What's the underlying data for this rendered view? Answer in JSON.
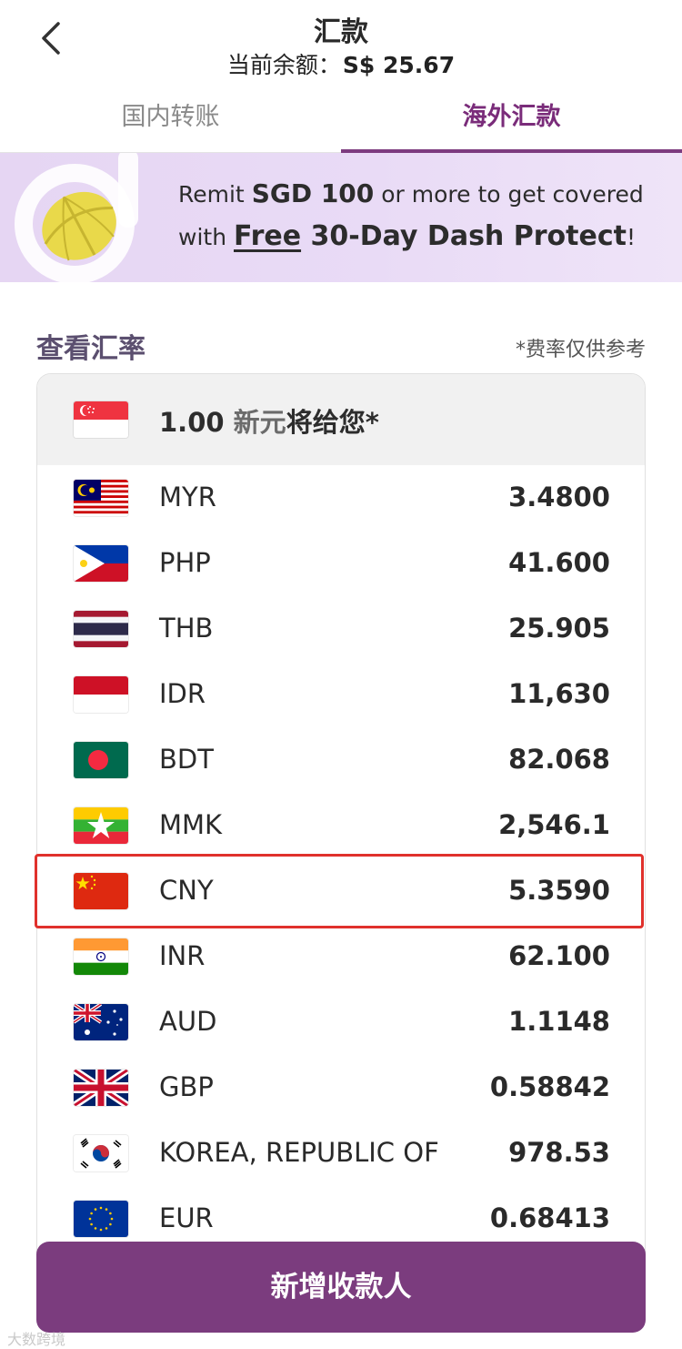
{
  "header": {
    "title": "汇款",
    "balance_label": "当前余额：",
    "balance_value": "S$ 25.67"
  },
  "tabs": [
    {
      "label": "国内转账",
      "active": false
    },
    {
      "label": "海外汇款",
      "active": true
    }
  ],
  "banner": {
    "line1_prefix": "Remit ",
    "line1_amount": "SGD 100",
    "line1_suffix": " or more to get covered",
    "line2_prefix": "with ",
    "line2_free": "Free",
    "line2_product": " 30-Day Dash Protect",
    "line2_end": "!"
  },
  "rates_section": {
    "title": "查看汇率",
    "note": "*费率仅供参考",
    "base": {
      "amount": "1.00",
      "currency": "新元",
      "suffix": "将给您*",
      "flag": "SG"
    },
    "rows": [
      {
        "flag": "MY",
        "code": "MYR",
        "rate": "3.4800"
      },
      {
        "flag": "PH",
        "code": "PHP",
        "rate": "41.600"
      },
      {
        "flag": "TH",
        "code": "THB",
        "rate": "25.905"
      },
      {
        "flag": "ID",
        "code": "IDR",
        "rate": "11,630"
      },
      {
        "flag": "BD",
        "code": "BDT",
        "rate": "82.068"
      },
      {
        "flag": "MM",
        "code": "MMK",
        "rate": "2,546.1"
      },
      {
        "flag": "CN",
        "code": "CNY",
        "rate": "5.3590",
        "highlighted": true
      },
      {
        "flag": "IN",
        "code": "INR",
        "rate": "62.100"
      },
      {
        "flag": "AU",
        "code": "AUD",
        "rate": "1.1148"
      },
      {
        "flag": "GB",
        "code": "GBP",
        "rate": "0.58842"
      },
      {
        "flag": "KR",
        "code": "KOREA, REPUBLIC OF",
        "rate": "978.53"
      },
      {
        "flag": "EU",
        "code": "EUR",
        "rate": "0.68413"
      }
    ]
  },
  "actions": {
    "add_recipient": "新增收款人"
  },
  "watermark": "大数跨境",
  "colors": {
    "brand": "#7b3c7e",
    "highlight_border": "#e0312c",
    "banner_bg": "#e6d6f3"
  }
}
